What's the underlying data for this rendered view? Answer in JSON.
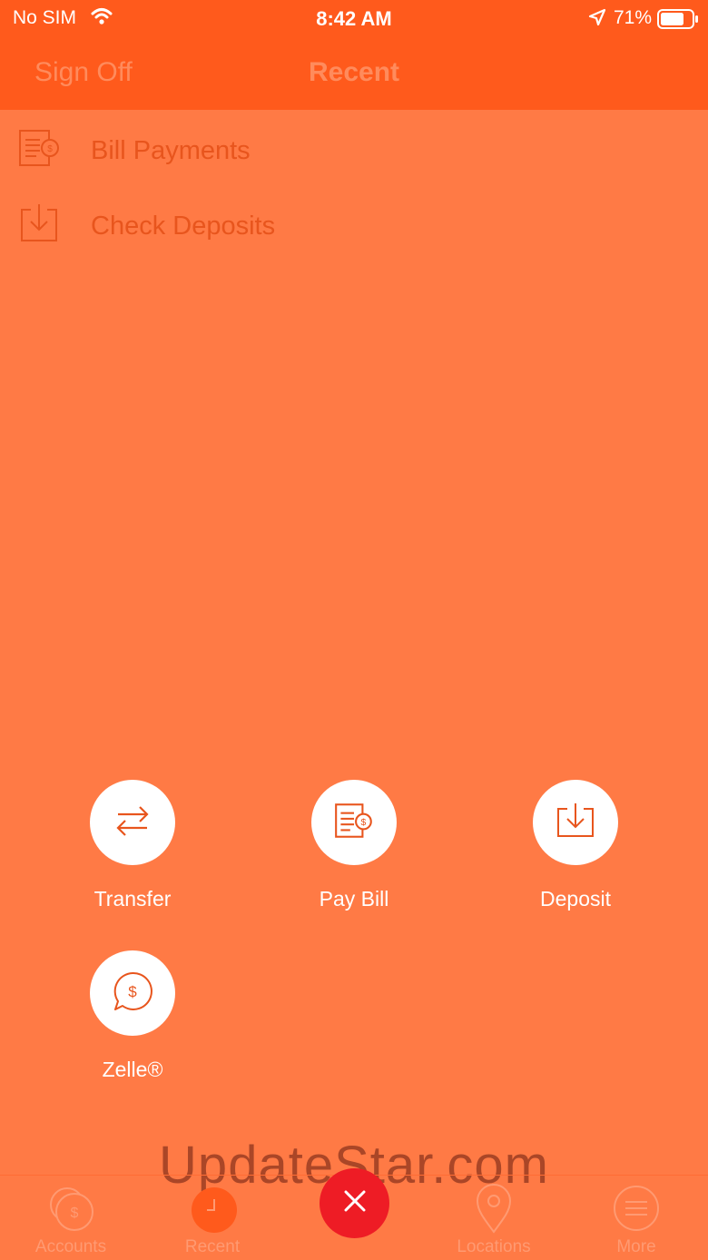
{
  "status_bar": {
    "carrier": "No SIM",
    "time": "8:42 AM",
    "battery_percent": "71%",
    "icons": [
      "wifi-icon",
      "location-arrow-icon",
      "battery-icon"
    ]
  },
  "header": {
    "left_button": "Sign Off",
    "title": "Recent"
  },
  "recent_list": [
    {
      "label": "Bill Payments",
      "icon": "bill-icon"
    },
    {
      "label": "Check Deposits",
      "icon": "deposit-icon"
    }
  ],
  "quick_actions": [
    {
      "label": "Transfer",
      "icon": "transfer-arrows-icon"
    },
    {
      "label": "Pay Bill",
      "icon": "bill-icon"
    },
    {
      "label": "Deposit",
      "icon": "deposit-icon"
    },
    {
      "label": "Zelle®",
      "icon": "zelle-chat-dollar-icon"
    }
  ],
  "watermark": "UpdateStar.com",
  "tab_bar": {
    "tabs": [
      {
        "label": "Accounts",
        "icon": "accounts-coin-icon"
      },
      {
        "label": "Recent",
        "icon": "recent-icon"
      },
      {
        "label": "Locations",
        "icon": "map-pin-icon"
      },
      {
        "label": "More",
        "icon": "menu-lines-icon"
      }
    ],
    "fab_icon": "close-icon"
  },
  "colors": {
    "header_bg": "#ff5a1c",
    "overlay_bg": "#ff7a45",
    "fab_red": "#ee1c25"
  }
}
